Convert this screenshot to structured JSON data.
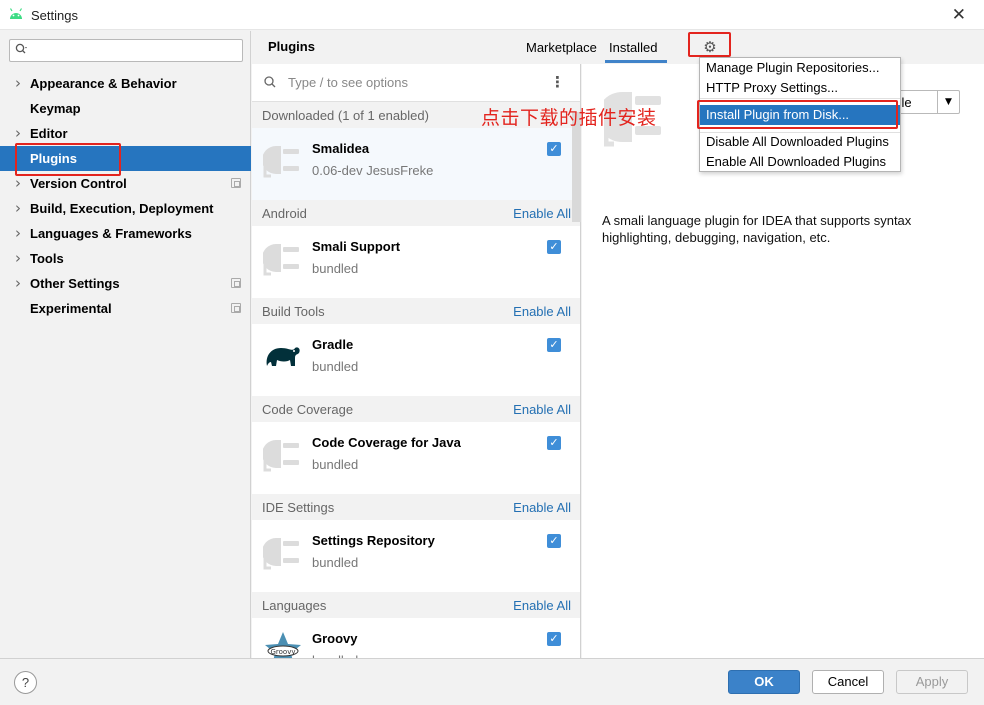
{
  "window": {
    "title": "Settings",
    "close_glyph": "✕"
  },
  "nav": {
    "search_icon": "magnifier-icon",
    "items": [
      {
        "label": "Appearance & Behavior",
        "expandable": true,
        "copy_icon": false,
        "selected": false
      },
      {
        "label": "Keymap",
        "expandable": false,
        "copy_icon": false,
        "selected": false
      },
      {
        "label": "Editor",
        "expandable": true,
        "copy_icon": false,
        "selected": false
      },
      {
        "label": "Plugins",
        "expandable": false,
        "copy_icon": false,
        "selected": true
      },
      {
        "label": "Version Control",
        "expandable": true,
        "copy_icon": true,
        "selected": false
      },
      {
        "label": "Build, Execution, Deployment",
        "expandable": true,
        "copy_icon": false,
        "selected": false
      },
      {
        "label": "Languages & Frameworks",
        "expandable": true,
        "copy_icon": false,
        "selected": false
      },
      {
        "label": "Tools",
        "expandable": true,
        "copy_icon": false,
        "selected": false
      },
      {
        "label": "Other Settings",
        "expandable": true,
        "copy_icon": true,
        "selected": false
      },
      {
        "label": "Experimental",
        "expandable": false,
        "copy_icon": true,
        "selected": false
      }
    ]
  },
  "header": {
    "title": "Plugins",
    "tabs": [
      {
        "label": "Marketplace",
        "active": false
      },
      {
        "label": "Installed",
        "active": true
      }
    ],
    "gear_icon": "gear-icon"
  },
  "list": {
    "search_placeholder": "Type / to see options",
    "groups": [
      {
        "label": "Downloaded (1 of 1 enabled)",
        "link": "",
        "plugins": [
          {
            "name": "Smalidea",
            "sub": "0.06-dev  JesusFreke",
            "icon": "plug-icon",
            "checked": true,
            "selected": true
          }
        ]
      },
      {
        "label": "Android",
        "link": "Enable All",
        "plugins": [
          {
            "name": "Smali Support",
            "sub": "bundled",
            "icon": "plug-icon",
            "checked": true
          }
        ]
      },
      {
        "label": "Build Tools",
        "link": "Enable All",
        "plugins": [
          {
            "name": "Gradle",
            "sub": "bundled",
            "icon": "gradle-elephant-icon",
            "checked": true
          }
        ]
      },
      {
        "label": "Code Coverage",
        "link": "Enable All",
        "plugins": [
          {
            "name": "Code Coverage for Java",
            "sub": "bundled",
            "icon": "plug-icon",
            "checked": true
          }
        ]
      },
      {
        "label": "IDE Settings",
        "link": "Enable All",
        "plugins": [
          {
            "name": "Settings Repository",
            "sub": "bundled",
            "icon": "plug-icon",
            "checked": true
          }
        ]
      },
      {
        "label": "Languages",
        "link": "Enable All",
        "plugins": [
          {
            "name": "Groovy",
            "sub": "bundled",
            "icon": "groovy-star-icon",
            "checked": true
          }
        ]
      }
    ]
  },
  "details": {
    "dropdown_text": "able",
    "description": "A smali language plugin for IDEA that supports syntax highlighting, debugging, navigation, etc."
  },
  "menu": {
    "items": [
      {
        "label": "Manage Plugin Repositories...",
        "active": false
      },
      {
        "label": "HTTP Proxy Settings...",
        "active": false
      },
      {
        "label": "Install Plugin from Disk...",
        "active": true
      },
      {
        "label": "Disable All Downloaded Plugins",
        "active": false
      },
      {
        "label": "Enable All Downloaded Plugins",
        "active": false
      }
    ]
  },
  "annotation": {
    "note": "点击下载的插件安装",
    "color": "#e3241e"
  },
  "footer": {
    "help": "?",
    "ok": "OK",
    "cancel": "Cancel",
    "apply": "Apply"
  },
  "colors": {
    "accent": "#2675bf",
    "link": "#2470b3",
    "checkbox": "#3f8ed8"
  }
}
